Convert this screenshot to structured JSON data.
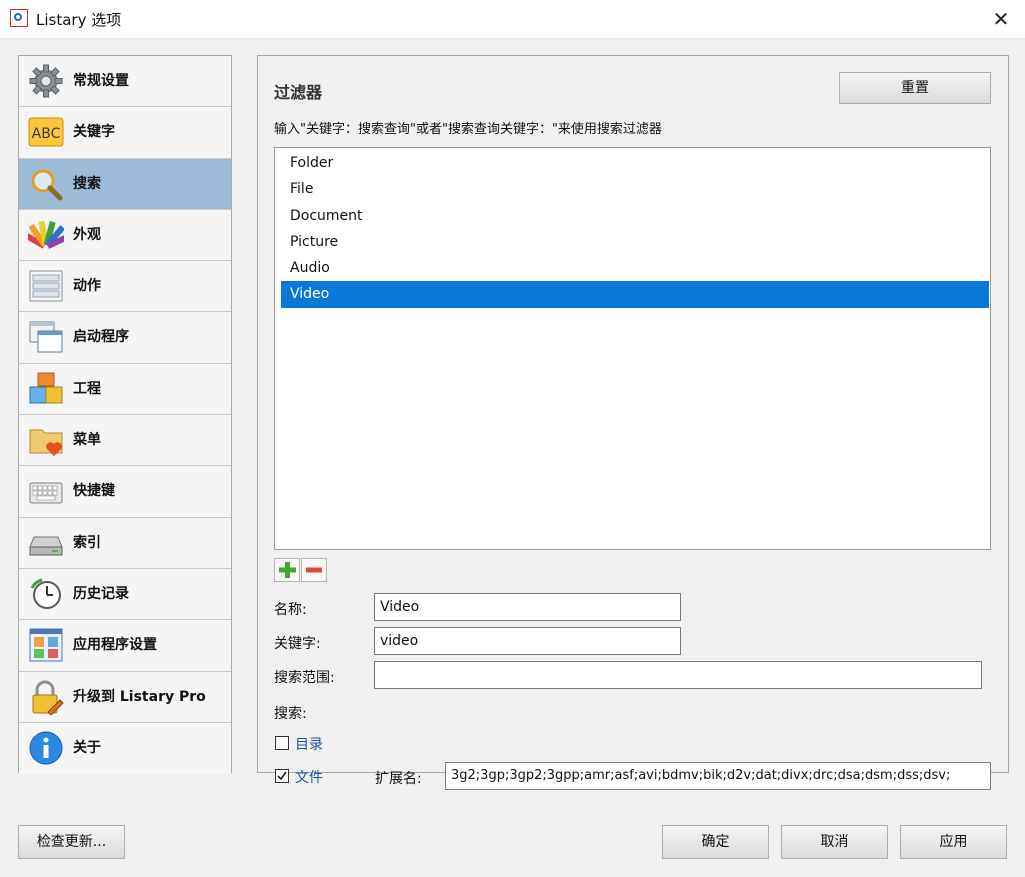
{
  "window": {
    "title": "Listary 选项",
    "close_label": "✕"
  },
  "sidebar": {
    "items": [
      {
        "label": "常规设置",
        "icon": "gear-icon",
        "selected": false
      },
      {
        "label": "关键字",
        "icon": "abc-icon",
        "selected": false
      },
      {
        "label": "搜索",
        "icon": "magnifier-icon",
        "selected": true
      },
      {
        "label": "外观",
        "icon": "palette-icon",
        "selected": false
      },
      {
        "label": "动作",
        "icon": "actions-list-icon",
        "selected": false
      },
      {
        "label": "启动程序",
        "icon": "windows-icon",
        "selected": false
      },
      {
        "label": "工程",
        "icon": "blocks-icon",
        "selected": false
      },
      {
        "label": "菜单",
        "icon": "folder-heart-icon",
        "selected": false
      },
      {
        "label": "快捷键",
        "icon": "keyboard-icon",
        "selected": false
      },
      {
        "label": "索引",
        "icon": "drive-icon",
        "selected": false
      },
      {
        "label": "历史记录",
        "icon": "history-clock-icon",
        "selected": false
      },
      {
        "label": "应用程序设置",
        "icon": "app-grid-icon",
        "selected": false
      },
      {
        "label": "升级到 Listary Pro",
        "icon": "lock-pencil-icon",
        "selected": false
      },
      {
        "label": "关于",
        "icon": "info-icon",
        "selected": false
      }
    ]
  },
  "filter": {
    "title": "过滤器",
    "reset_label": "重置",
    "hint": "输入\"关键字：搜索查询\"或者\"搜索查询关键字：\"来使用搜索过滤器",
    "list": [
      "Folder",
      "File",
      "Document",
      "Picture",
      "Audio",
      "Video"
    ],
    "selected_index": 5
  },
  "form": {
    "name_label": "名称:",
    "name_value": "Video",
    "keyword_label": "关键字:",
    "keyword_value": "video",
    "scope_label": "搜索范围:",
    "scope_value": "",
    "search_label": "搜索:",
    "directory_label": "目录",
    "directory_checked": false,
    "file_label": "文件",
    "file_checked": true,
    "ext_label": "扩展名:",
    "ext_value": "3g2;3gp;3gp2;3gpp;amr;asf;avi;bdmv;bik;d2v;dat;divx;drc;dsa;dsm;dss;dsv;"
  },
  "footer": {
    "check_update": "检查更新...",
    "ok": "确定",
    "cancel": "取消",
    "apply": "应用"
  },
  "colors": {
    "selected_nav": "#9dbbd7",
    "selected_list": "#0a78d7",
    "link": "#1a55a0"
  }
}
